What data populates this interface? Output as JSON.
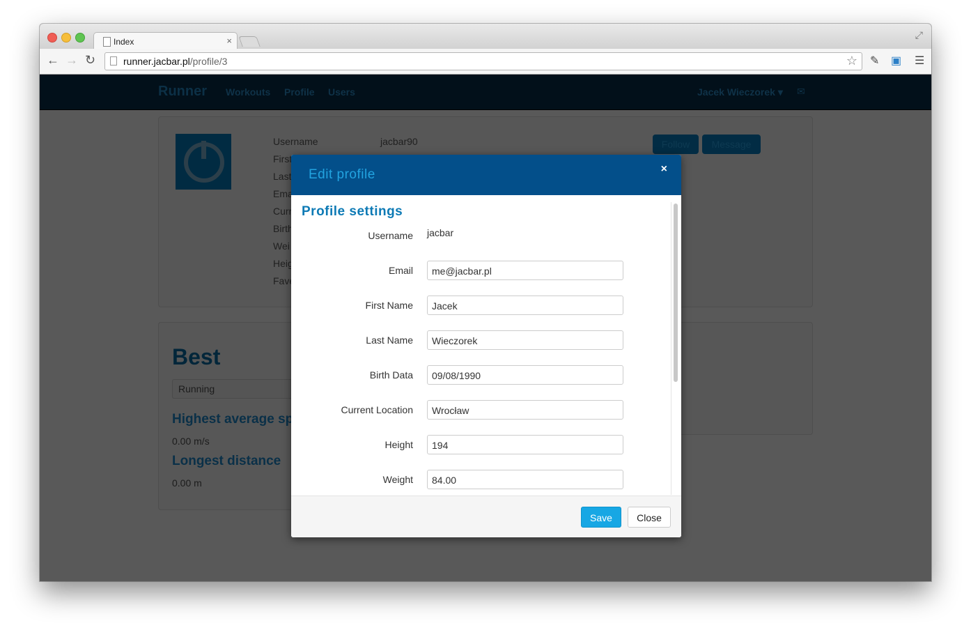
{
  "browser": {
    "tab_title": "Index",
    "tab_close": "×",
    "url_host": "runner.jacbar.pl",
    "url_path": "/profile/3"
  },
  "navbar": {
    "brand": "Runner",
    "links": [
      "Workouts",
      "Profile",
      "Users"
    ],
    "user": "Jacek Wieczorek ▾",
    "envelope": "✉"
  },
  "profile": {
    "labels": [
      "Username",
      "First",
      "Last",
      "Ema",
      "Curr",
      "Birth",
      "Wei",
      "Heig",
      "Fave"
    ],
    "username_value": "jacbar90",
    "follow_label": "Follow",
    "message_label": "Message"
  },
  "best": {
    "title": "Best",
    "dropdown": "Running",
    "speed_title": "Highest average sp",
    "speed_value": "0.00 m/s",
    "distance_title": "Longest distance",
    "distance_value": "0.00 m"
  },
  "modal": {
    "title": "Edit profile",
    "close_icon": "×",
    "section_title": "Profile settings",
    "username_label": "Username",
    "username_value": "jacbar",
    "fields": [
      {
        "label": "Email",
        "value": "me@jacbar.pl"
      },
      {
        "label": "First Name",
        "value": "Jacek"
      },
      {
        "label": "Last Name",
        "value": "Wieczorek"
      },
      {
        "label": "Birth Data",
        "value": "09/08/1990"
      },
      {
        "label": "Current Location",
        "value": "Wrocław"
      },
      {
        "label": "Height",
        "value": "194"
      },
      {
        "label": "Weight",
        "value": "84.00"
      }
    ],
    "save_label": "Save",
    "close_label": "Close"
  },
  "colors": {
    "modal_header": "#034f8a",
    "accent": "#17a7e4",
    "overlay": "#595959"
  }
}
